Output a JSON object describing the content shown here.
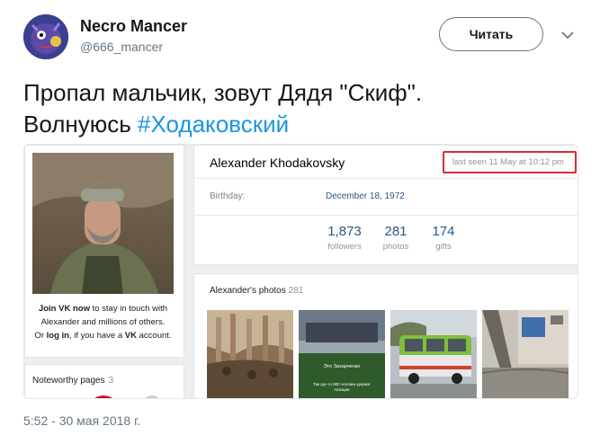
{
  "tweet": {
    "display_name": "Necro Mancer",
    "handle": "@666_mancer",
    "follow_label": "Читать",
    "text_line1": "Пропал мальчик, зовут Дядя \"Скиф\".",
    "text_line2_prefix": "Волнуюсь ",
    "hashtag": "#Ходаковский",
    "timestamp": "5:52 - 30 мая 2018 г."
  },
  "vk": {
    "join_bold1": "Join VK now",
    "join_text1": " to stay in touch with Alexander and millions of others.",
    "join_text2_prefix": "Or ",
    "join_bold2": "log in",
    "join_text2_mid": ", if you have a ",
    "join_bold3": "VK",
    "join_text2_end": " account.",
    "noteworthy_title": "Noteworthy pages",
    "noteworthy_count": "3",
    "name": "Alexander Khodakovsky",
    "last_seen": "last seen 11 May at 10:12 pm",
    "birthday_label": "Birthday:",
    "birthday_value": "December 18, 1972",
    "stats": [
      {
        "num": "1,873",
        "label": "followers"
      },
      {
        "num": "281",
        "label": "photos"
      },
      {
        "num": "174",
        "label": "gifts"
      }
    ],
    "photos_title": "Alexander's photos",
    "photos_count": "281",
    "thumb2_caption1": "Это Захарченко",
    "thumb2_caption2": "Так где-то 900 человек держат",
    "thumb2_caption3": "позиции"
  },
  "colors": {
    "hashtag": "#1b95e0",
    "vk_link": "#2a5885",
    "highlight": "#d32f2f"
  },
  "icons": {
    "menu": "chevron-down-icon"
  }
}
